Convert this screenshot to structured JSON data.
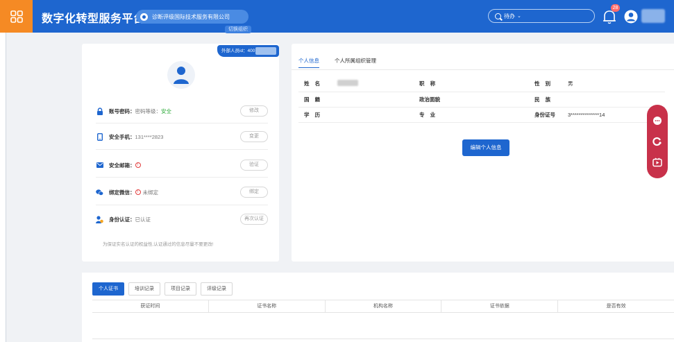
{
  "header": {
    "app_title": "数字化转型服务平台",
    "org_name": "诊断评级国际技术服务有限公司",
    "switch_org_label": "切换组织",
    "search_label": "待办",
    "notification_count": "28",
    "brand_color": "#1e66cf"
  },
  "profile": {
    "external_id_label": "外部人员id：400",
    "security_rows": [
      {
        "label": "账号密码：",
        "value": "密码等级：",
        "status": "安全",
        "button": "修改"
      },
      {
        "label": "安全手机：",
        "value": "131****2823",
        "button": "变更"
      },
      {
        "label": "安全邮箱：",
        "value": "",
        "button": "验证"
      },
      {
        "label": "绑定微信：",
        "value": "未绑定",
        "button": "绑定"
      },
      {
        "label": "身份认证：",
        "value": "已认证",
        "button": "再次认证"
      }
    ],
    "note": "为保证实名认证的权益性,认证通过的信息尽量不要更改!"
  },
  "info": {
    "tabs": [
      "个人信息",
      "个人所属组织管理"
    ],
    "rows": [
      [
        "姓 名",
        "",
        "职 称",
        "",
        "性 别",
        "男"
      ],
      [
        "国 籍",
        "",
        "政治面貌",
        "",
        "民 族",
        ""
      ],
      [
        "学 历",
        "",
        "专 业",
        "",
        "身份证号",
        "3**************14"
      ]
    ],
    "edit_button": "编辑个人信息"
  },
  "certificates": {
    "tabs": [
      "个人证书",
      "培训记录",
      "项目记录",
      "评级记录"
    ],
    "columns": [
      "获证时间",
      "证书名称",
      "机构名称",
      "证书依据",
      "是否有效"
    ]
  }
}
